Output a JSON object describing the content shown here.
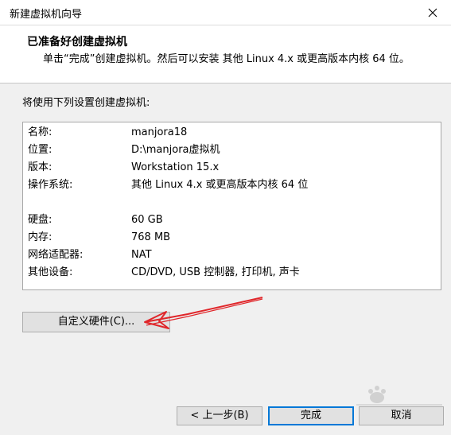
{
  "window": {
    "title": "新建虚拟机向导"
  },
  "header": {
    "title": "已准备好创建虚拟机",
    "description": "单击“完成”创建虚拟机。然后可以安装 其他 Linux 4.x 或更高版本内核 64 位。"
  },
  "intro": "将使用下列设置创建虚拟机:",
  "summary": {
    "rows": [
      {
        "key": "名称:",
        "value": "manjora18"
      },
      {
        "key": "位置:",
        "value": "D:\\manjora虚拟机"
      },
      {
        "key": "版本:",
        "value": "Workstation 15.x"
      },
      {
        "key": "操作系统:",
        "value": "其他 Linux 4.x 或更高版本内核 64 位"
      },
      {
        "key": "硬盘:",
        "value": "60 GB"
      },
      {
        "key": "内存:",
        "value": "768 MB"
      },
      {
        "key": "网络适配器:",
        "value": "NAT"
      },
      {
        "key": "其他设备:",
        "value": "CD/DVD, USB 控制器, 打印机, 声卡"
      }
    ]
  },
  "buttons": {
    "customize": "自定义硬件(C)...",
    "back": "< 上一步(B)",
    "finish": "完成",
    "cancel": "取消"
  },
  "icons": {
    "close": "close-icon",
    "annotation": "red-arrow-annotation"
  },
  "colors": {
    "accent": "#0078d7",
    "annotation": "#e0262a"
  }
}
